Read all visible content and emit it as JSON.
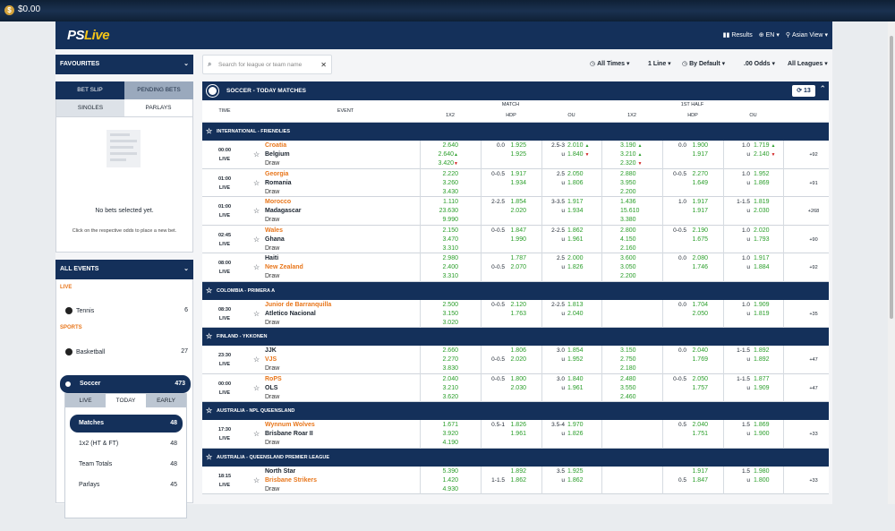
{
  "balance": {
    "amount": "$0.00"
  },
  "header": {
    "logo": "PS",
    "logo_accent": "Live",
    "results": "Results",
    "lang": "EN",
    "view": "Asian View"
  },
  "left": {
    "favourites": "FAVOURITES",
    "bet_slip": "BET SLIP",
    "pending_bets": "PENDING BETS",
    "singles": "SINGLES",
    "parlays": "PARLAYS",
    "empty_title": "No bets selected yet.",
    "empty_hint": "Click on the respective odds to place a new bet.",
    "all_events": "ALL EVENTS",
    "live_label": "LIVE",
    "tennis": "Tennis",
    "tennis_count": "6",
    "sports_label": "SPORTS",
    "basketball": "Basketball",
    "basketball_count": "27",
    "soccer": "Soccer",
    "soccer_count": "473",
    "tab_live": "LIVE",
    "tab_today": "TODAY",
    "tab_early": "EARLY",
    "markets": [
      {
        "label": "Matches",
        "count": "48"
      },
      {
        "label": "1x2 (HT & FT)",
        "count": "48"
      },
      {
        "label": "Team Totals",
        "count": "48"
      },
      {
        "label": "Parlays",
        "count": "45"
      }
    ]
  },
  "filters": {
    "search_placeholder": "Search for league or team name",
    "times": "All Times",
    "lines": "1 Line",
    "sort": "By Default",
    "odds": ".00 Odds",
    "leagues": "All Leagues"
  },
  "sport_header": {
    "title": "SOCCER - TODAY MATCHES",
    "refresh_count": "13"
  },
  "columns": {
    "time": "TIME",
    "event": "EVENT",
    "match": "MATCH",
    "first_half": "1ST HALF",
    "x12": "1X2",
    "hdp": "HDP",
    "ou": "OU"
  },
  "leagues": [
    {
      "name": "INTERNATIONAL - FRIENDLIES",
      "events": [
        {
          "time": "00:00",
          "status": "LIVE",
          "home": "Croatia",
          "away": "Belgium",
          "draw": "Draw",
          "fav": "home",
          "x12": [
            "2.640",
            "2.640",
            "3.420"
          ],
          "x12_arrows": [
            "",
            "up",
            "dn"
          ],
          "hdp_line": [
            "0.0",
            ""
          ],
          "hdp": [
            "1.925",
            "1.925"
          ],
          "ou_line": [
            "2.5-3",
            "u"
          ],
          "ou": [
            "2.010",
            "1.840"
          ],
          "ou_arrows": [
            "up",
            "dn"
          ],
          "h_x12": [
            "3.190",
            "3.210",
            "2.320"
          ],
          "h_x12_arrows": [
            "up",
            "up",
            "dn"
          ],
          "h_hdp_line": [
            "0.0",
            ""
          ],
          "h_hdp": [
            "1.900",
            "1.917"
          ],
          "h_ou_line": [
            "1.0",
            "u"
          ],
          "h_ou": [
            "1.719",
            "2.140"
          ],
          "h_ou_arrows": [
            "up",
            "dn"
          ],
          "more": "+92"
        },
        {
          "time": "01:00",
          "status": "LIVE",
          "home": "Georgia",
          "away": "Romania",
          "draw": "Draw",
          "fav": "home",
          "x12": [
            "2.220",
            "3.260",
            "3.430"
          ],
          "x12_arrows": [
            "",
            "",
            ""
          ],
          "hdp_line": [
            "0-0.5",
            ""
          ],
          "hdp": [
            "1.917",
            "1.934"
          ],
          "ou_line": [
            "2.5",
            "u"
          ],
          "ou": [
            "2.050",
            "1.806"
          ],
          "ou_arrows": [
            "",
            ""
          ],
          "h_x12": [
            "2.880",
            "3.950",
            "2.200"
          ],
          "h_x12_arrows": [
            "",
            "",
            ""
          ],
          "h_hdp_line": [
            "0-0.5",
            ""
          ],
          "h_hdp": [
            "2.270",
            "1.649"
          ],
          "h_ou_line": [
            "1.0",
            "u"
          ],
          "h_ou": [
            "1.952",
            "1.869"
          ],
          "h_ou_arrows": [
            "",
            ""
          ],
          "more": "+91"
        },
        {
          "time": "01:00",
          "status": "LIVE",
          "home": "Morocco",
          "away": "Madagascar",
          "draw": "Draw",
          "fav": "home",
          "x12": [
            "1.110",
            "23.630",
            "9.990"
          ],
          "x12_arrows": [
            "",
            "",
            ""
          ],
          "hdp_line": [
            "2-2.5",
            ""
          ],
          "hdp": [
            "1.854",
            "2.020"
          ],
          "ou_line": [
            "3-3.5",
            "u"
          ],
          "ou": [
            "1.917",
            "1.934"
          ],
          "ou_arrows": [
            "",
            ""
          ],
          "h_x12": [
            "1.436",
            "15.610",
            "3.380"
          ],
          "h_x12_arrows": [
            "",
            "",
            ""
          ],
          "h_hdp_line": [
            "1.0",
            ""
          ],
          "h_hdp": [
            "1.917",
            "1.917"
          ],
          "h_ou_line": [
            "1-1.5",
            "u"
          ],
          "h_ou": [
            "1.819",
            "2.030"
          ],
          "h_ou_arrows": [
            "",
            ""
          ],
          "more": "+268"
        },
        {
          "time": "02:45",
          "status": "LIVE",
          "home": "Wales",
          "away": "Ghana",
          "draw": "Draw",
          "fav": "home",
          "x12": [
            "2.150",
            "3.470",
            "3.310"
          ],
          "x12_arrows": [
            "",
            "",
            ""
          ],
          "hdp_line": [
            "0-0.5",
            ""
          ],
          "hdp": [
            "1.847",
            "1.990"
          ],
          "ou_line": [
            "2-2.5",
            "u"
          ],
          "ou": [
            "1.862",
            "1.961"
          ],
          "ou_arrows": [
            "",
            ""
          ],
          "h_x12": [
            "2.800",
            "4.150",
            "2.160"
          ],
          "h_x12_arrows": [
            "",
            "",
            ""
          ],
          "h_hdp_line": [
            "0-0.5",
            ""
          ],
          "h_hdp": [
            "2.190",
            "1.675"
          ],
          "h_ou_line": [
            "1.0",
            "u"
          ],
          "h_ou": [
            "2.020",
            "1.793"
          ],
          "h_ou_arrows": [
            "",
            ""
          ],
          "more": "+90"
        },
        {
          "time": "08:00",
          "status": "LIVE",
          "home": "Haiti",
          "away": "New Zealand",
          "draw": "Draw",
          "fav": "away",
          "x12": [
            "2.980",
            "2.400",
            "3.310"
          ],
          "x12_arrows": [
            "",
            "",
            ""
          ],
          "hdp_line": [
            "",
            "0-0.5"
          ],
          "hdp": [
            "1.787",
            "2.070"
          ],
          "ou_line": [
            "2.5",
            "u"
          ],
          "ou": [
            "2.000",
            "1.826"
          ],
          "ou_arrows": [
            "",
            ""
          ],
          "h_x12": [
            "3.600",
            "3.050",
            "2.200"
          ],
          "h_x12_arrows": [
            "",
            "",
            ""
          ],
          "h_hdp_line": [
            "0.0",
            ""
          ],
          "h_hdp": [
            "2.080",
            "1.746"
          ],
          "h_ou_line": [
            "1.0",
            "u"
          ],
          "h_ou": [
            "1.917",
            "1.884"
          ],
          "h_ou_arrows": [
            "",
            ""
          ],
          "more": "+92"
        }
      ]
    },
    {
      "name": "COLOMBIA - PRIMERA A",
      "events": [
        {
          "time": "08:30",
          "status": "LIVE",
          "home": "Junior de Barranquilla",
          "away": "Atletico Nacional",
          "draw": "Draw",
          "fav": "home",
          "x12": [
            "2.500",
            "3.150",
            "3.020"
          ],
          "x12_arrows": [
            "",
            "",
            ""
          ],
          "hdp_line": [
            "0-0.5",
            ""
          ],
          "hdp": [
            "2.120",
            "1.763"
          ],
          "ou_line": [
            "2-2.5",
            "u"
          ],
          "ou": [
            "1.813",
            "2.040"
          ],
          "ou_arrows": [
            "",
            ""
          ],
          "h_x12": [
            "",
            "",
            ""
          ],
          "h_x12_arrows": [
            "",
            "",
            ""
          ],
          "h_hdp_line": [
            "0.0",
            ""
          ],
          "h_hdp": [
            "1.704",
            "2.050"
          ],
          "h_ou_line": [
            "1.0",
            "u"
          ],
          "h_ou": [
            "1.909",
            "1.819"
          ],
          "h_ou_arrows": [
            "",
            ""
          ],
          "more": "+35"
        }
      ]
    },
    {
      "name": "FINLAND - YKKONEN",
      "events": [
        {
          "time": "23:30",
          "status": "LIVE",
          "home": "JJK",
          "away": "VJS",
          "draw": "Draw",
          "fav": "away",
          "x12": [
            "2.660",
            "2.270",
            "3.830"
          ],
          "x12_arrows": [
            "",
            "",
            ""
          ],
          "hdp_line": [
            "",
            "0-0.5"
          ],
          "hdp": [
            "1.806",
            "2.020"
          ],
          "ou_line": [
            "3.0",
            "u"
          ],
          "ou": [
            "1.854",
            "1.952"
          ],
          "ou_arrows": [
            "",
            ""
          ],
          "h_x12": [
            "3.150",
            "2.750",
            "2.180"
          ],
          "h_x12_arrows": [
            "",
            "",
            ""
          ],
          "h_hdp_line": [
            "0.0",
            ""
          ],
          "h_hdp": [
            "2.040",
            "1.769"
          ],
          "h_ou_line": [
            "1-1.5",
            "u"
          ],
          "h_ou": [
            "1.892",
            "1.892"
          ],
          "h_ou_arrows": [
            "",
            ""
          ],
          "more": "+47"
        },
        {
          "time": "00:00",
          "status": "LIVE",
          "home": "RoPS",
          "away": "OLS",
          "draw": "Draw",
          "fav": "home",
          "x12": [
            "2.040",
            "3.210",
            "3.620"
          ],
          "x12_arrows": [
            "",
            "",
            ""
          ],
          "hdp_line": [
            "0-0.5",
            ""
          ],
          "hdp": [
            "1.800",
            "2.030"
          ],
          "ou_line": [
            "3.0",
            "u"
          ],
          "ou": [
            "1.840",
            "1.961"
          ],
          "ou_arrows": [
            "",
            ""
          ],
          "h_x12": [
            "2.480",
            "3.550",
            "2.460"
          ],
          "h_x12_arrows": [
            "",
            "",
            ""
          ],
          "h_hdp_line": [
            "0-0.5",
            ""
          ],
          "h_hdp": [
            "2.050",
            "1.757"
          ],
          "h_ou_line": [
            "1-1.5",
            "u"
          ],
          "h_ou": [
            "1.877",
            "1.909"
          ],
          "h_ou_arrows": [
            "",
            ""
          ],
          "more": "+47"
        }
      ]
    },
    {
      "name": "AUSTRALIA - NPL QUEENSLAND",
      "events": [
        {
          "time": "17:30",
          "status": "LIVE",
          "home": "Wynnum Wolves",
          "away": "Brisbane Roar II",
          "draw": "Draw",
          "fav": "home",
          "x12": [
            "1.671",
            "3.920",
            "4.190"
          ],
          "x12_arrows": [
            "",
            "",
            ""
          ],
          "hdp_line": [
            "0.5-1",
            ""
          ],
          "hdp": [
            "1.826",
            "1.961"
          ],
          "ou_line": [
            "3.5-4",
            "u"
          ],
          "ou": [
            "1.970",
            "1.826"
          ],
          "ou_arrows": [
            "",
            ""
          ],
          "h_x12": [
            "",
            "",
            ""
          ],
          "h_x12_arrows": [
            "",
            "",
            ""
          ],
          "h_hdp_line": [
            "0.5",
            ""
          ],
          "h_hdp": [
            "2.040",
            "1.751"
          ],
          "h_ou_line": [
            "1.5",
            "u"
          ],
          "h_ou": [
            "1.869",
            "1.900"
          ],
          "h_ou_arrows": [
            "",
            ""
          ],
          "more": "+33"
        }
      ]
    },
    {
      "name": "AUSTRALIA - QUEENSLAND PREMIER LEAGUE",
      "events": [
        {
          "time": "18:15",
          "status": "LIVE",
          "home": "North Star",
          "away": "Brisbane Strikers",
          "draw": "Draw",
          "fav": "away",
          "x12": [
            "5.390",
            "1.420",
            "4.930"
          ],
          "x12_arrows": [
            "",
            "",
            ""
          ],
          "hdp_line": [
            "",
            "1-1.5"
          ],
          "hdp": [
            "1.892",
            "1.862"
          ],
          "ou_line": [
            "3.5",
            "u"
          ],
          "ou": [
            "1.925",
            "1.862"
          ],
          "ou_arrows": [
            "",
            ""
          ],
          "h_x12": [
            "",
            "",
            ""
          ],
          "h_x12_arrows": [
            "",
            "",
            ""
          ],
          "h_hdp_line": [
            "",
            "0.5"
          ],
          "h_hdp": [
            "1.917",
            "1.847"
          ],
          "h_ou_line": [
            "1.5",
            "u"
          ],
          "h_ou": [
            "1.980",
            "1.800"
          ],
          "h_ou_arrows": [
            "",
            ""
          ],
          "more": "+33"
        }
      ]
    }
  ]
}
